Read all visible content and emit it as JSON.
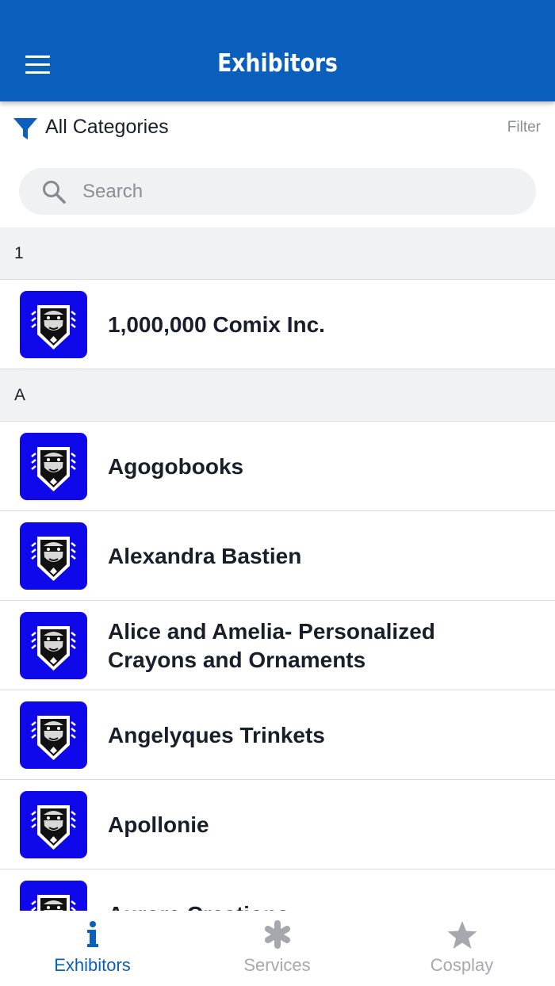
{
  "app_bar": {
    "title": "Exhibitors",
    "color": "#0a5fbd"
  },
  "filter": {
    "category": "All Categories",
    "button_label": "Filter"
  },
  "search": {
    "placeholder": "Search",
    "value": ""
  },
  "sections": [
    {
      "letter": "1",
      "items": [
        {
          "name": "1,000,000 Comix Inc."
        }
      ]
    },
    {
      "letter": "A",
      "items": [
        {
          "name": "Agogobooks"
        },
        {
          "name": "Alexandra Bastien"
        },
        {
          "name": "Alice and Amelia- Personalized Crayons and Ornaments"
        },
        {
          "name": "Angelyques Trinkets"
        },
        {
          "name": "Apollonie"
        },
        {
          "name": "Aurora Creations"
        }
      ]
    }
  ],
  "tabs": [
    {
      "label": "Exhibitors",
      "icon": "info-icon",
      "active": true
    },
    {
      "label": "Services",
      "icon": "asterisk-icon",
      "active": false
    },
    {
      "label": "Cosplay",
      "icon": "star-icon",
      "active": false
    }
  ],
  "colors": {
    "accent": "#0a5fbd",
    "logo_bg": "#0f08ea",
    "inactive": "#a6a8ad"
  }
}
